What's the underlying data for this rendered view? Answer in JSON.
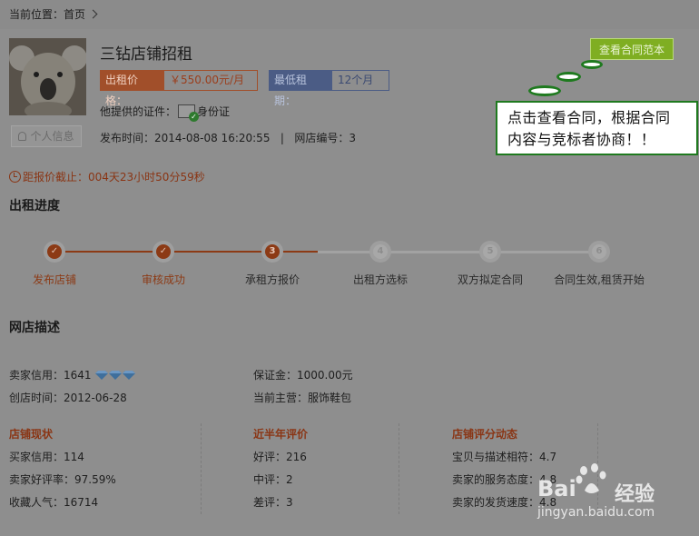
{
  "breadcrumb": {
    "label": "当前位置：首页"
  },
  "shop": {
    "title": "三钻店铺招租",
    "price_label": "出租价格：",
    "price_value": "￥550.00元/月",
    "min_label": "最低租期：",
    "min_value": "12个月",
    "cert_label": "他提供的证件：",
    "cert_value": "身份证",
    "pub_time": "发布时间：2014-08-08 16:20:55",
    "shop_no": "网店编号：3",
    "personal_button": "个人信息"
  },
  "deadline": "距报价截止：004天23小时50分59秒",
  "progress": {
    "title": "出租进度",
    "steps": [
      {
        "num": "✓",
        "label": "发布店铺"
      },
      {
        "num": "✓",
        "label": "审核成功"
      },
      {
        "num": "3",
        "label": "承租方报价"
      },
      {
        "num": "4",
        "label": "出租方选标"
      },
      {
        "num": "5",
        "label": "双方拟定合同"
      },
      {
        "num": "6",
        "label": "合同生效,租赁开始"
      }
    ],
    "current_step": 3
  },
  "description": {
    "title": "网店描述",
    "seller_credit": "卖家信用：1641",
    "seller_credit_diamonds": 3,
    "deposit": "保证金：1000.00元",
    "created": "创店时间：2012-06-28",
    "main_business": "当前主营：服饰鞋包"
  },
  "columns": [
    {
      "title": "店铺现状",
      "lines": [
        "买家信用：114",
        "卖家好评率：97.59%",
        "收藏人气：16714"
      ]
    },
    {
      "title": "近半年评价",
      "lines": [
        "好评：216",
        "中评：2",
        "差评：3"
      ]
    },
    {
      "title": "店铺评分动态",
      "lines": [
        "宝贝与描述相符：4.7",
        "卖家的服务态度：4.8",
        "卖家的发货速度：4.8"
      ]
    }
  ],
  "contract_button": "查看合同范本",
  "callout": {
    "line1": "点击查看合同，根据合同",
    "line2": "内容与竞标者协商！！"
  },
  "watermark": {
    "brand": "Bai",
    "brand_suffix": "经验",
    "url": "jingyan.baidu.com"
  },
  "colors": {
    "accent": "#8c3a15",
    "green": "#7fae22",
    "blue": "#4b5c85"
  }
}
